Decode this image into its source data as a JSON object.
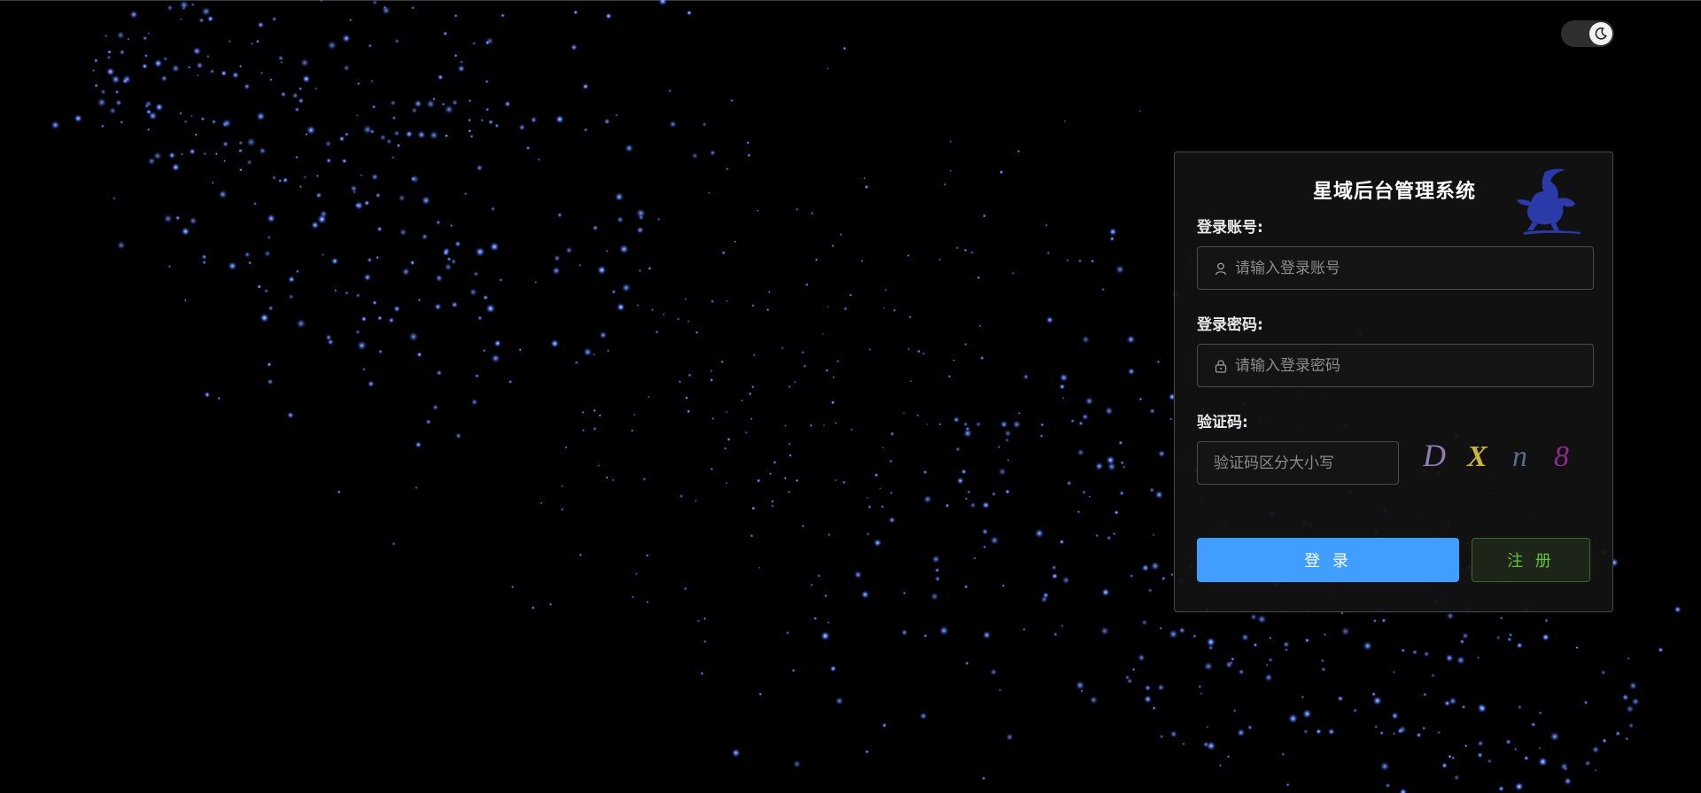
{
  "app": {
    "title": "星域后台管理系统"
  },
  "theme_toggle": {
    "icon": "moon-icon",
    "mode": "dark"
  },
  "form": {
    "account": {
      "label": "登录账号:",
      "placeholder": "请输入登录账号",
      "value": "",
      "icon": "user-icon"
    },
    "password": {
      "label": "登录密码:",
      "placeholder": "请输入登录密码",
      "value": "",
      "icon": "lock-icon"
    },
    "captcha": {
      "label": "验证码:",
      "placeholder": "验证码区分大小写",
      "value": "",
      "chars": [
        "D",
        "X",
        "n",
        "8"
      ],
      "char_colors": [
        "#8f7ab8",
        "#c9b53c",
        "#566e8c",
        "#8e2b8e"
      ]
    }
  },
  "buttons": {
    "login": "登 录",
    "register": "注 册"
  },
  "colors": {
    "background": "#000000",
    "star": "#5b8cff",
    "primary": "#409eff",
    "success": "#67c23a",
    "logo": "#2a3aa8"
  }
}
